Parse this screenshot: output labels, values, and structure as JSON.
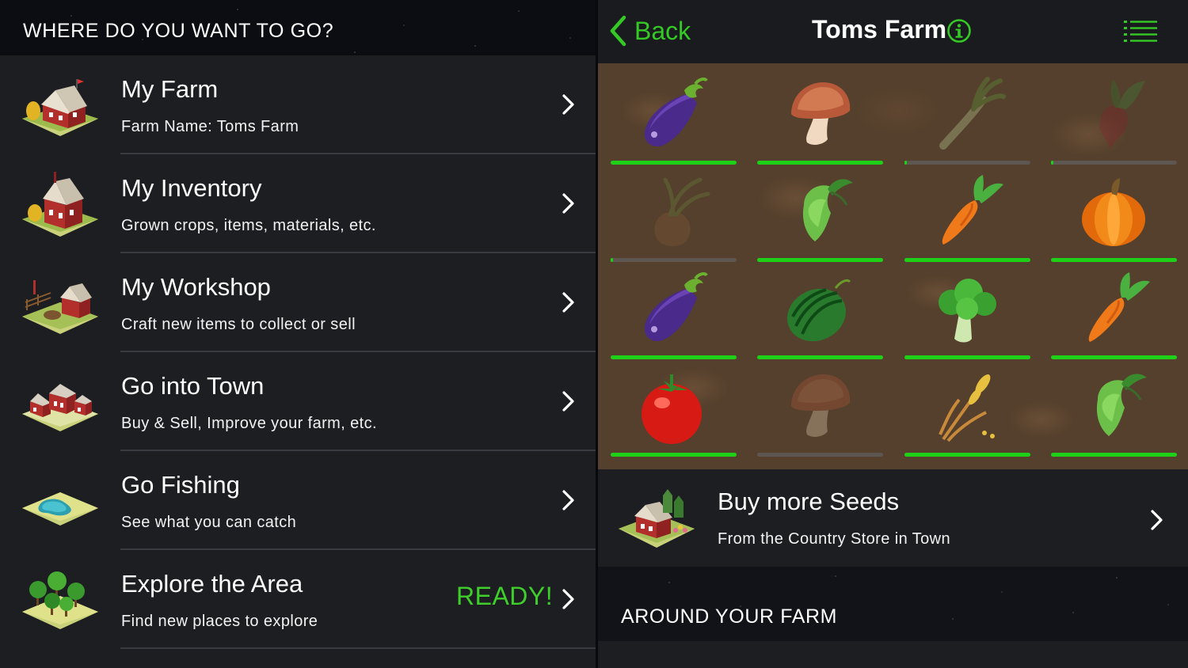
{
  "left_panel": {
    "header_title": "WHERE DO YOU WANT TO GO?",
    "menu": [
      {
        "title": "My Farm",
        "subtitle": "Farm Name: Toms Farm",
        "icon": "farm-barn-icon"
      },
      {
        "title": "My Inventory",
        "subtitle": "Grown crops, items, materials, etc.",
        "icon": "inventory-barn-icon"
      },
      {
        "title": "My Workshop",
        "subtitle": "Craft new items to collect or sell",
        "icon": "workshop-icon"
      },
      {
        "title": "Go into Town",
        "subtitle": "Buy & Sell, Improve your farm, etc.",
        "icon": "town-icon"
      },
      {
        "title": "Go Fishing",
        "subtitle": "See what you can catch",
        "icon": "pond-icon"
      },
      {
        "title": "Explore the Area",
        "subtitle": "Find new places to explore",
        "icon": "forest-icon",
        "badge": "READY!"
      }
    ]
  },
  "right_panel": {
    "back_label": "Back",
    "farm_title": "Toms Farm",
    "grid": [
      {
        "crop": "eggplant",
        "progress": 1.0,
        "faded": false
      },
      {
        "crop": "mushroom",
        "progress": 1.0,
        "faded": false
      },
      {
        "crop": "leek",
        "progress": 0.01,
        "faded": true
      },
      {
        "crop": "beet",
        "progress": 0.02,
        "faded": true
      },
      {
        "crop": "onion",
        "progress": 0.01,
        "faded": true
      },
      {
        "crop": "hops",
        "progress": 1.0,
        "faded": false
      },
      {
        "crop": "carrot",
        "progress": 1.0,
        "faded": false
      },
      {
        "crop": "pumpkin",
        "progress": 1.0,
        "faded": false
      },
      {
        "crop": "eggplant",
        "progress": 1.0,
        "faded": false
      },
      {
        "crop": "watermelon",
        "progress": 1.0,
        "faded": false
      },
      {
        "crop": "broccoli",
        "progress": 1.0,
        "faded": false
      },
      {
        "crop": "carrot",
        "progress": 1.0,
        "faded": false
      },
      {
        "crop": "tomato",
        "progress": 1.0,
        "faded": false
      },
      {
        "crop": "mushroom",
        "progress": 0.0,
        "faded": true
      },
      {
        "crop": "wheat",
        "progress": 1.0,
        "faded": false
      },
      {
        "crop": "hops",
        "progress": 1.0,
        "faded": false
      }
    ],
    "seeds": {
      "title": "Buy more Seeds",
      "subtitle": "From the Country Store in Town",
      "icon": "country-store-icon"
    },
    "section_label": "AROUND YOUR FARM"
  },
  "colors": {
    "accent_green": "#34c924",
    "ready_green": "#3fcf2b",
    "progress_green": "#1ed017"
  }
}
